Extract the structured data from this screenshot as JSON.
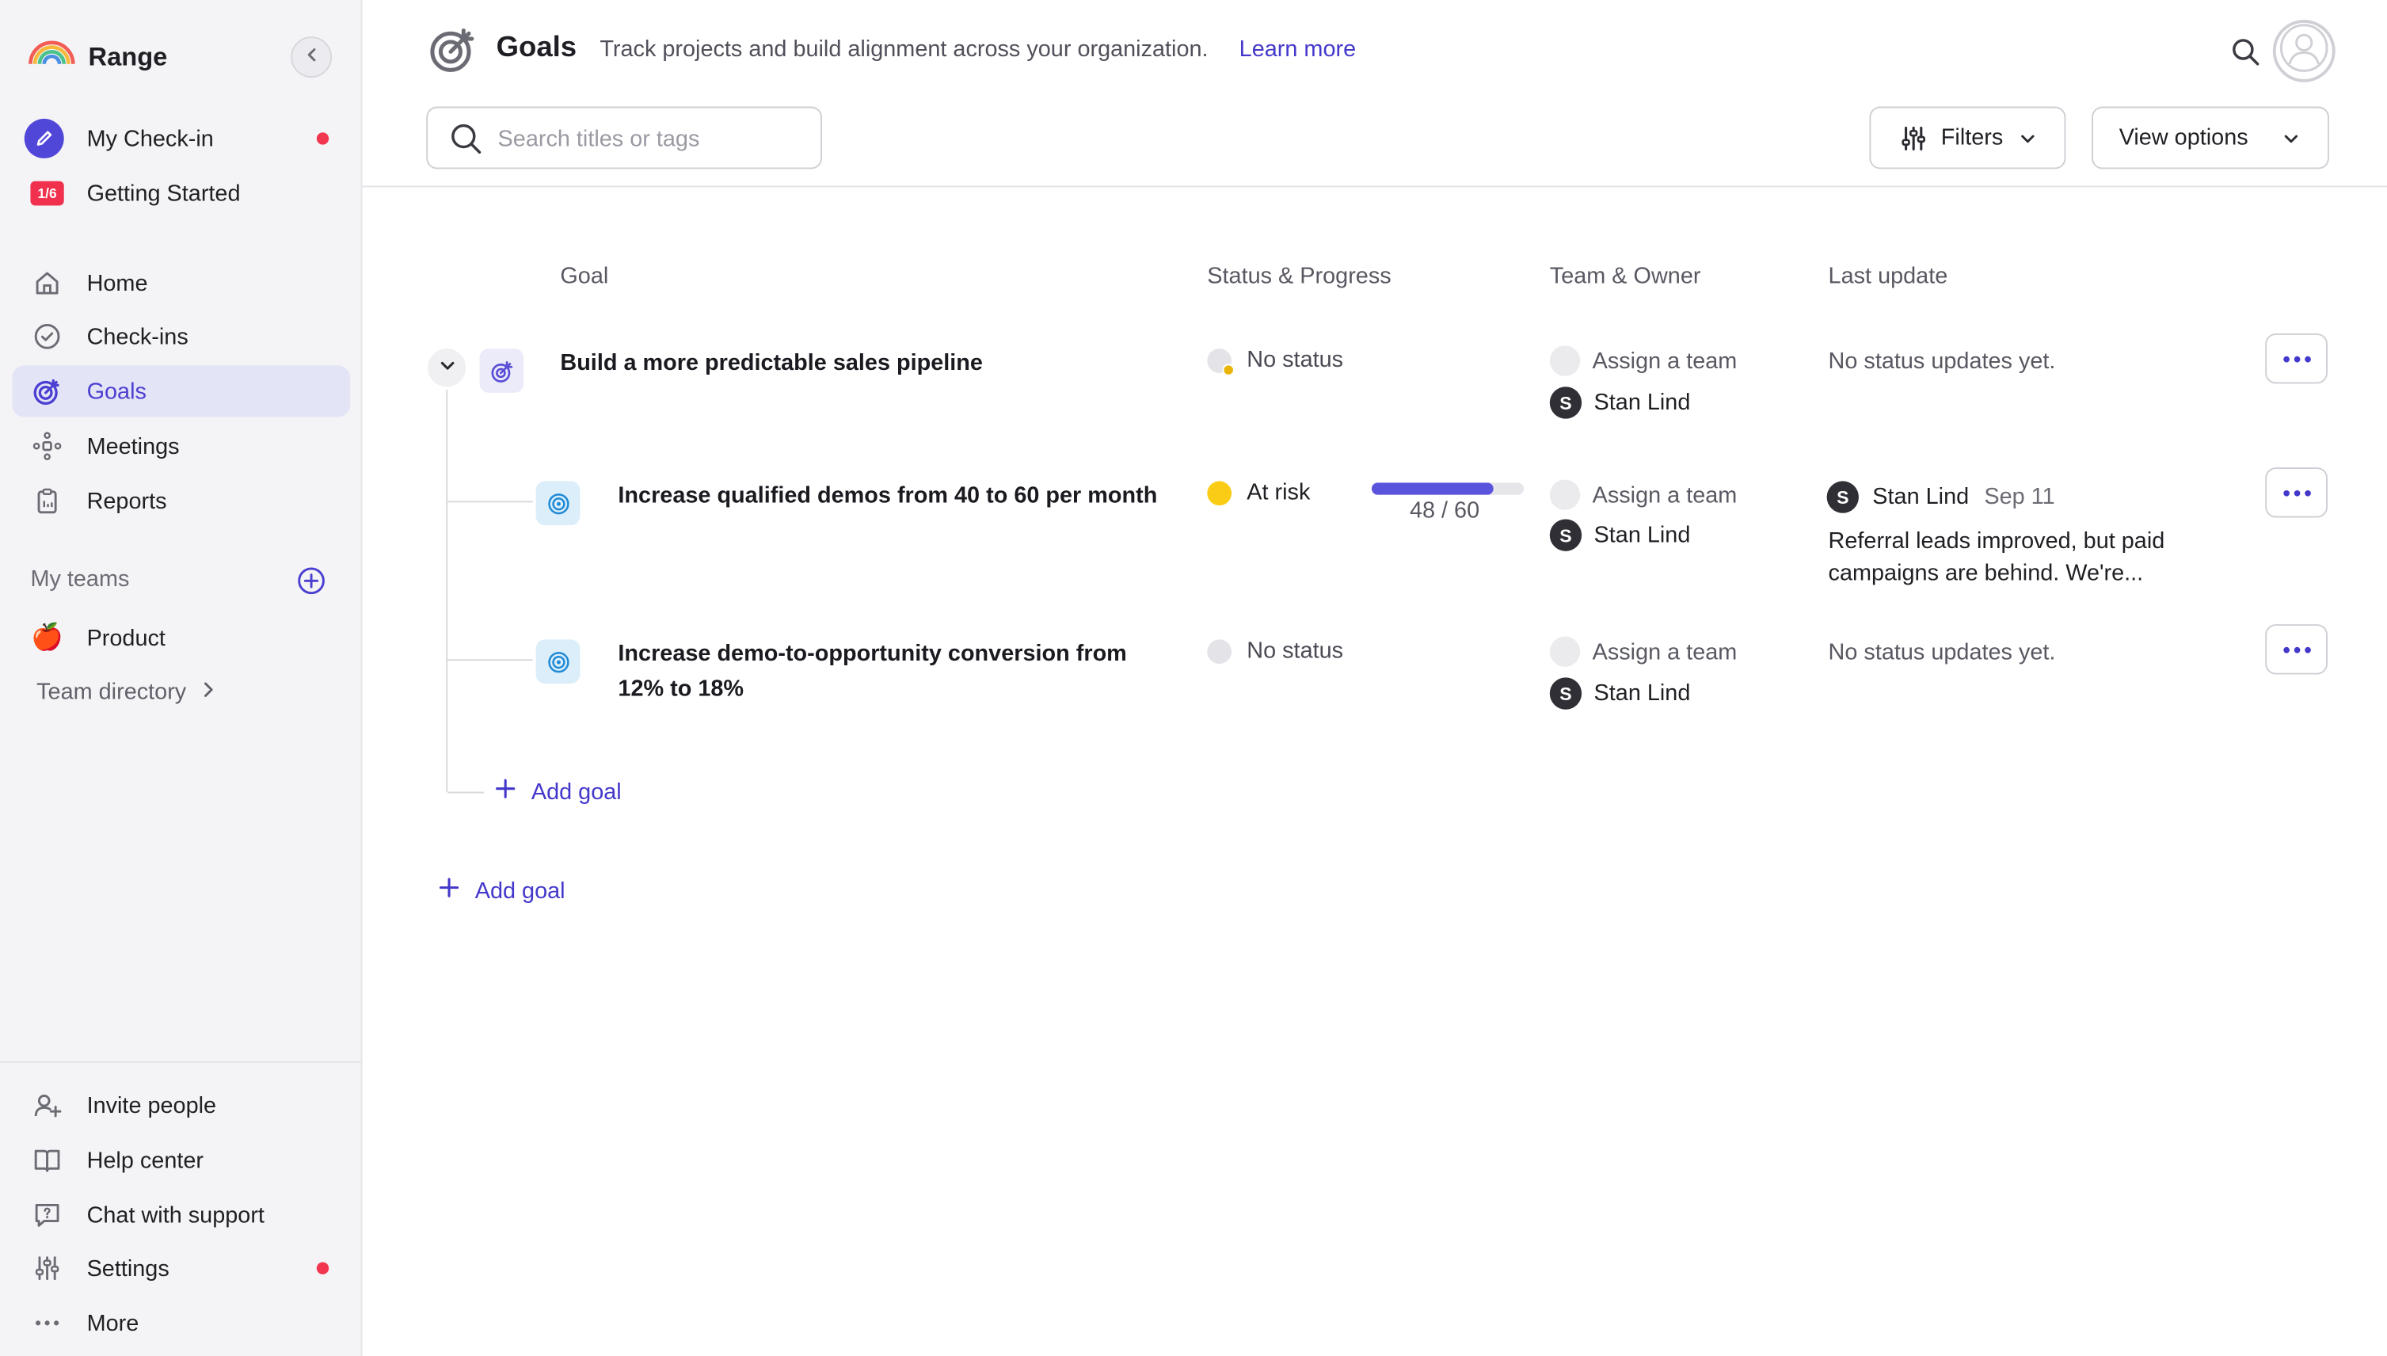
{
  "app": {
    "name": "Range"
  },
  "sidebar": {
    "primary": [
      {
        "label": "My Check-in",
        "icon": "pencil-icon",
        "notify": true
      },
      {
        "label": "Getting Started",
        "icon": "progress-badge-icon",
        "badge": "1/6"
      }
    ],
    "nav": [
      {
        "label": "Home",
        "icon": "home-icon"
      },
      {
        "label": "Check-ins",
        "icon": "check-circle-icon"
      },
      {
        "label": "Goals",
        "icon": "goals-target-icon",
        "active": true
      },
      {
        "label": "Meetings",
        "icon": "meetings-icon"
      },
      {
        "label": "Reports",
        "icon": "clipboard-icon"
      }
    ],
    "my_teams_label": "My teams",
    "teams": [
      {
        "label": "Product",
        "emoji": "🍎"
      }
    ],
    "team_directory_label": "Team directory",
    "footer": [
      {
        "label": "Invite people",
        "icon": "add-person-icon"
      },
      {
        "label": "Help center",
        "icon": "book-icon"
      },
      {
        "label": "Chat with support",
        "icon": "chat-question-icon"
      },
      {
        "label": "Settings",
        "icon": "sliders-icon",
        "notify": true
      },
      {
        "label": "More",
        "icon": "more-dots-icon"
      }
    ]
  },
  "header": {
    "title": "Goals",
    "subtitle": "Track projects and build alignment across your organization.",
    "learn_more": "Learn more",
    "search_placeholder": "Search titles or tags",
    "filters_label": "Filters",
    "view_options_label": "View options"
  },
  "table": {
    "columns": [
      "Goal",
      "Status & Progress",
      "Team & Owner",
      "Last update"
    ],
    "rows": [
      {
        "title": "Build a more predictable sales pipeline",
        "status": "No status",
        "team": "Assign a team",
        "owner": "Stan Lind",
        "owner_initial": "S",
        "last_update": "No status updates yet."
      },
      {
        "title": "Increase qualified demos from 40 to 60 per month",
        "status": "At risk",
        "progress_text": "48 / 60",
        "progress_fraction": 0.8,
        "team": "Assign a team",
        "owner": "Stan Lind",
        "owner_initial": "S",
        "update_author": "Stan Lind",
        "update_author_initial": "S",
        "update_date": "Sep 11",
        "update_text": "Referral leads improved, but paid campaigns are behind. We're..."
      },
      {
        "title": "Increase demo-to-opportunity conversion from 12% to 18%",
        "status": "No status",
        "team": "Assign a team",
        "owner": "Stan Lind",
        "owner_initial": "S",
        "last_update": "No status updates yet."
      }
    ],
    "add_goal_child": "Add goal",
    "add_goal_root": "Add goal"
  },
  "colors": {
    "accent": "#4338ca",
    "active_nav_bg": "#e4e4f7",
    "notify_red": "#f2364f",
    "at_risk": "#facc15",
    "progress": "#5a54dc"
  }
}
